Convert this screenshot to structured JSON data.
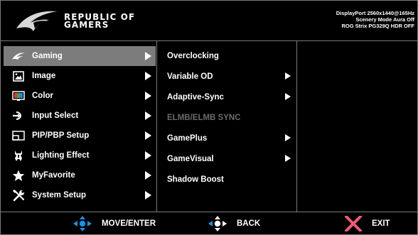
{
  "header": {
    "brand_line1": "REPUBLIC OF",
    "brand_line2": "GAMERS",
    "status_lines": [
      "DisplayPort 2560x1440@165Hz",
      "Scenery Mode Aura Off",
      "ROG Strix PG329Q HDR OFF"
    ]
  },
  "main_menu": [
    {
      "label": "Gaming",
      "icon": "rog-eye-icon",
      "selected": true
    },
    {
      "label": "Image",
      "icon": "image-icon"
    },
    {
      "label": "Color",
      "icon": "color-icon"
    },
    {
      "label": "Input Select",
      "icon": "input-icon"
    },
    {
      "label": "PIP/PBP Setup",
      "icon": "pip-icon"
    },
    {
      "label": "Lighting Effect",
      "icon": "lighting-icon"
    },
    {
      "label": "MyFavorite",
      "icon": "star-icon"
    },
    {
      "label": "System Setup",
      "icon": "wrench-icon"
    }
  ],
  "submenu": [
    {
      "label": "Overclocking",
      "has_arrow": false,
      "enabled": true
    },
    {
      "label": "Variable OD",
      "has_arrow": true,
      "enabled": true
    },
    {
      "label": "Adaptive-Sync",
      "has_arrow": true,
      "enabled": true
    },
    {
      "label": "ELMB/ELMB SYNC",
      "has_arrow": false,
      "enabled": false
    },
    {
      "label": "GamePlus",
      "has_arrow": true,
      "enabled": true
    },
    {
      "label": "GameVisual",
      "has_arrow": true,
      "enabled": true
    },
    {
      "label": "Shadow Boost",
      "has_arrow": false,
      "enabled": true
    }
  ],
  "footer": {
    "move_label": "MOVE/ENTER",
    "back_label": "BACK",
    "exit_label": "EXIT"
  },
  "colors": {
    "selected_bg": "#7c7c7c",
    "nav_blue": "#1e8fe0",
    "exit_pink": "#f05a7a",
    "disabled_text": "#6a6a6a"
  }
}
